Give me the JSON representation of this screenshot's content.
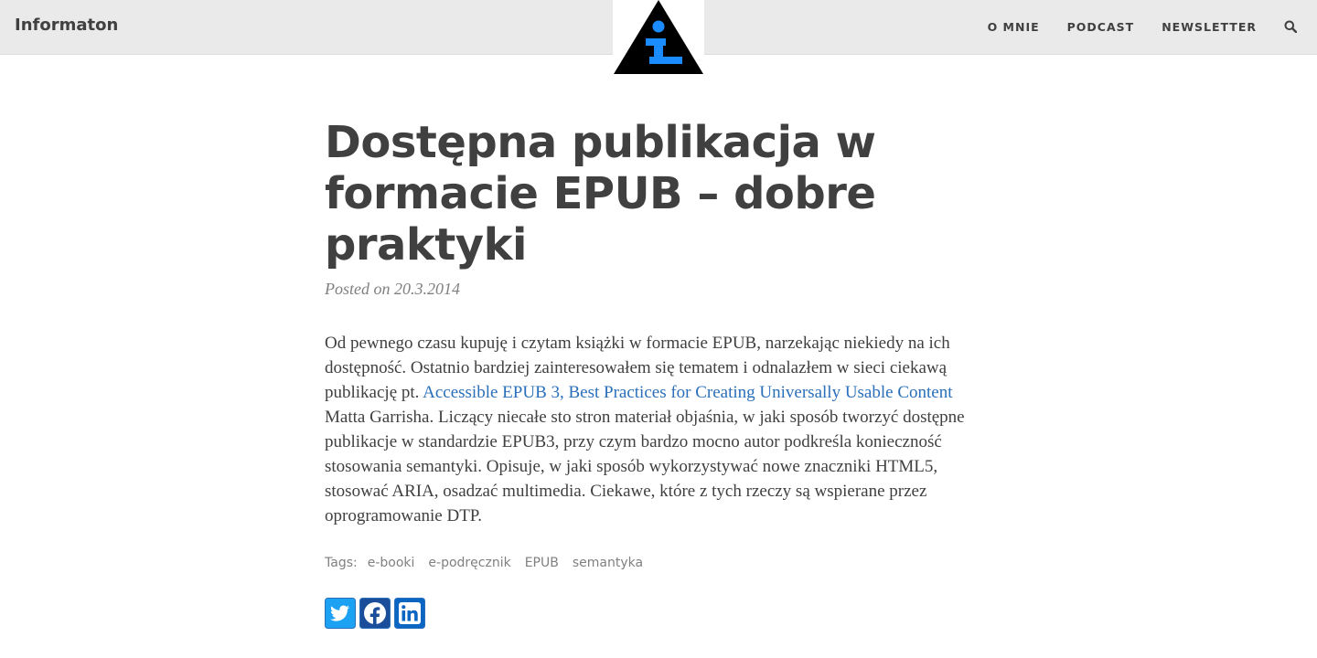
{
  "header": {
    "brand": "Informaton",
    "nav": [
      {
        "label": "O MNIE"
      },
      {
        "label": "PODCAST"
      },
      {
        "label": "NEWSLETTER"
      }
    ],
    "icons": {
      "search": "search-icon",
      "logo": "info-triangle-logo"
    }
  },
  "post": {
    "title": "Dostępna publikacja w formacie EPUB – dobre praktyki",
    "meta": "Posted on 20.3.2014",
    "body": {
      "text_before_link": "Od pewnego czasu kupuję i czytam książki w formacie EPUB, narzekając niekiedy na ich dostępność. Ostatnio bardziej zainteresowałem się tematem i odnalazłem w sieci ciekawą publikację pt. ",
      "link_text": "Accessible EPUB 3, Best Practices for Creating Universally Usable Content",
      "text_after_link": " Matta Garrisha. Liczący niecałe sto stron materiał objaśnia, w jaki sposób tworzyć dostępne publikacje w standardzie EPUB3, przy czym bardzo mocno autor podkreśla konieczność stosowania semantyki. Opisuje, w jaki sposób wykorzystywać nowe znaczniki HTML5, stosować ARIA, osadzać multimedia. Ciekawe, które z tych rzeczy są wspierane przez oprogramowanie DTP."
    },
    "tags_label": "Tags:",
    "tags": [
      "e-booki",
      "e-podręcznik",
      "EPUB",
      "semantyka"
    ]
  },
  "share": {
    "icons": [
      "twitter-icon",
      "facebook-icon",
      "linkedin-icon"
    ]
  },
  "colors": {
    "header_bg": "#eaeaea",
    "text": "#404040",
    "link": "#2a6fba",
    "logo_accent": "#1a8cff"
  }
}
